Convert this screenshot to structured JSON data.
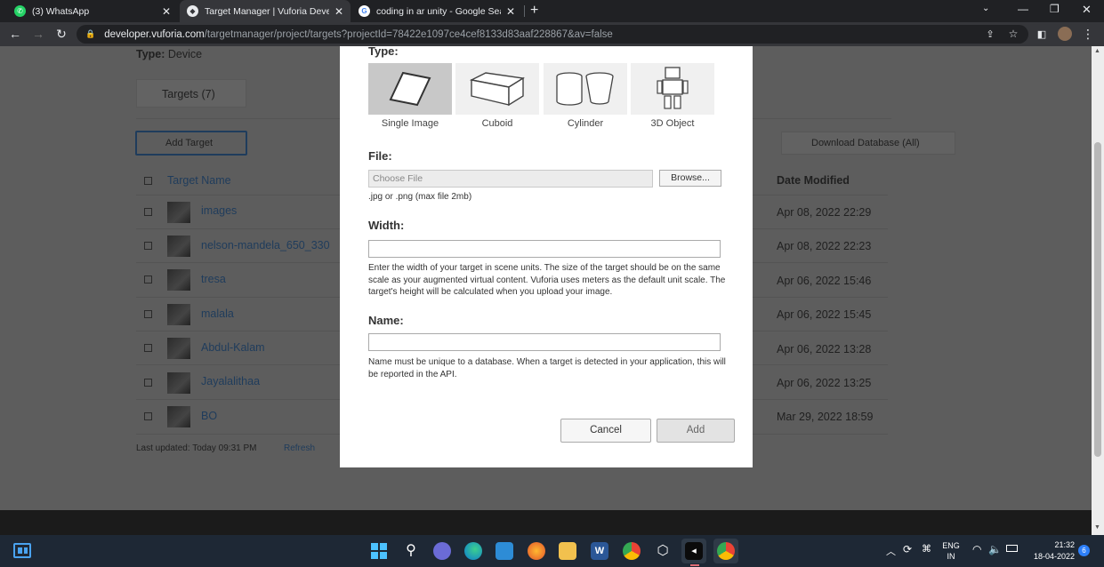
{
  "browser": {
    "tabs": [
      {
        "title": "(3) WhatsApp",
        "icon": "whatsapp-icon",
        "color": "#25d366"
      },
      {
        "title": "Target Manager | Vuforia Develop",
        "icon": "vuforia-icon",
        "color": "#ffffff"
      },
      {
        "title": "coding in ar unity - Google Searc",
        "icon": "google-icon",
        "color": "#4285f4"
      }
    ],
    "new_tab": "+",
    "url_host": "developer.vuforia.com",
    "url_path": "/targetmanager/project/targets?projectId=78422e1097ce4cef8133d83aaf228867&av=false"
  },
  "page": {
    "type_label": "Type:",
    "type_value": "Device",
    "targets_tab": "Targets (7)",
    "add_target": "Add Target",
    "download_db": "Download Database (All)",
    "col_name": "Target Name",
    "col_date": "Date Modified",
    "rows": [
      {
        "name": "images",
        "date": "Apr 08, 2022 22:29"
      },
      {
        "name": "nelson-mandela_650_330",
        "date": "Apr 08, 2022 22:23"
      },
      {
        "name": "tresa",
        "date": "Apr 06, 2022 15:46"
      },
      {
        "name": "malala",
        "date": "Apr 06, 2022 15:45"
      },
      {
        "name": "Abdul-Kalam",
        "date": "Apr 06, 2022 13:28"
      },
      {
        "name": "Jayalalithaa",
        "date": "Apr 06, 2022 13:25"
      },
      {
        "name": "BO",
        "date": "Mar 29, 2022 18:59"
      }
    ],
    "last_updated": "Last updated: Today 09:31 PM",
    "refresh": "Refresh"
  },
  "modal": {
    "type_heading": "Type:",
    "types": [
      {
        "label": "Single Image",
        "icon": "single-image-icon",
        "selected": true
      },
      {
        "label": "Cuboid",
        "icon": "cuboid-icon",
        "selected": false
      },
      {
        "label": "Cylinder",
        "icon": "cylinder-icon",
        "selected": false
      },
      {
        "label": "3D Object",
        "icon": "3d-object-icon",
        "selected": false
      }
    ],
    "file_heading": "File:",
    "file_placeholder": "Choose File",
    "browse": "Browse...",
    "file_hint": ".jpg or .png (max file 2mb)",
    "width_heading": "Width:",
    "width_value": "",
    "width_hint": "Enter the width of your target in scene units. The size of the target should be on the same scale as your augmented virtual content. Vuforia uses meters as the default unit scale. The target's height will be calculated when you upload your image.",
    "name_heading": "Name:",
    "name_value": "",
    "name_hint": "Name must be unique to a database. When a target is detected in your application, this will be reported in the API.",
    "cancel": "Cancel",
    "add": "Add"
  },
  "taskbar": {
    "lang_top": "ENG",
    "lang_bottom": "IN",
    "time": "21:32",
    "date": "18-04-2022",
    "notification_count": "6"
  }
}
